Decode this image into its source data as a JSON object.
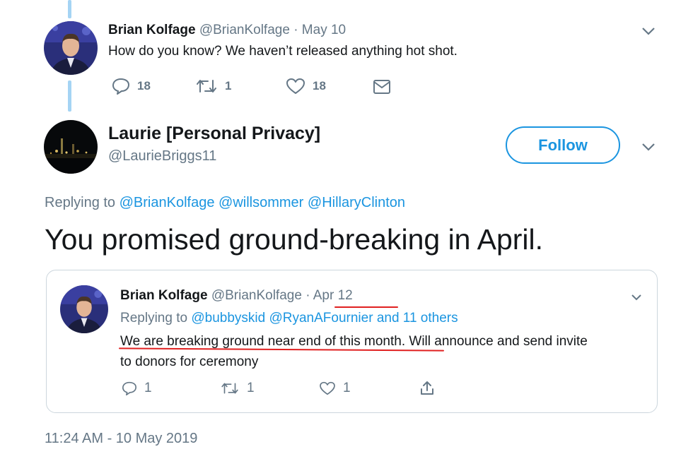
{
  "tweet1": {
    "author_name": "Brian Kolfage",
    "author_handle": "@BrianKolfage",
    "date": "· May 10",
    "text": "How do you know? We haven’t released anything hot shot.",
    "replies": "18",
    "retweets": "1",
    "likes": "18"
  },
  "tweet2": {
    "author_name": "Laurie [Personal Privacy]",
    "author_handle": "@LaurieBriggs11",
    "follow_label": "Follow",
    "replying_prefix": "Replying to",
    "replying_to": [
      "@BrianKolfage",
      "@willsommer",
      "@HillaryClinton"
    ],
    "text": "You promised ground-breaking in April.",
    "timestamp": "11:24 AM - 10 May 2019"
  },
  "quoted": {
    "author_name": "Brian Kolfage",
    "author_handle": "@BrianKolfage",
    "date_sep": "·",
    "date": "Apr 12",
    "replying_prefix": "Replying to",
    "replying_to": [
      "@bubbyskid",
      "@RyanAFournier",
      "and 11 others"
    ],
    "text_line1_underlined": "We are breaking ground near end of this month.",
    "text_line1_rest": " Will announce and send invite",
    "text_line2": "to donors for ceremony",
    "replies": "1",
    "retweets": "1",
    "likes": "1"
  },
  "icons": {
    "reply": "reply-icon",
    "retweet": "retweet-icon",
    "like": "heart-icon",
    "dm": "envelope-icon",
    "share": "share-icon",
    "more": "chevron-down-icon"
  },
  "colors": {
    "link": "#1b95e0",
    "thread_line": "#a5d4f4",
    "muted": "#657786",
    "annotation": "#e02020"
  }
}
